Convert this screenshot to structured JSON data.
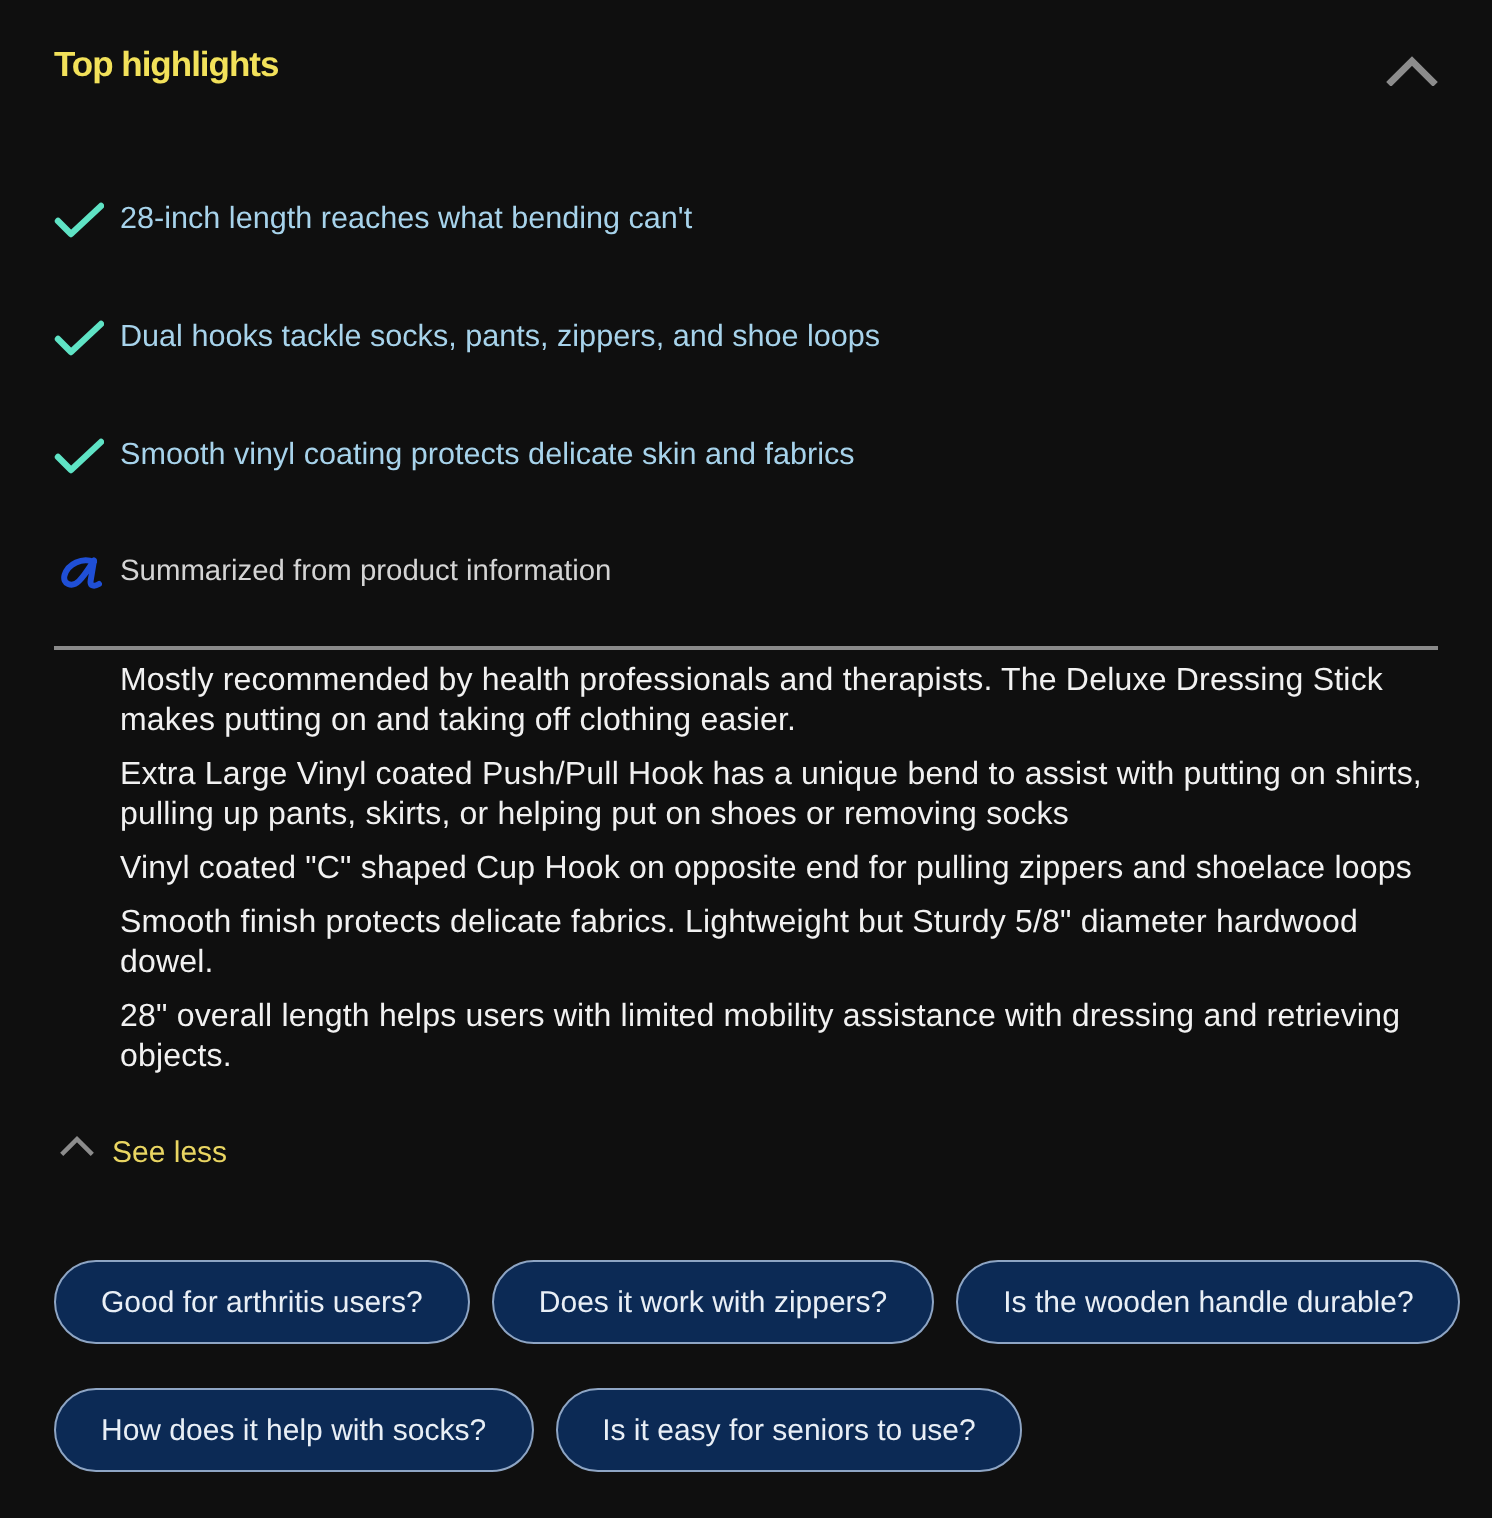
{
  "section": {
    "title": "Top highlights",
    "expanded": true
  },
  "highlights": [
    "28-inch length reaches what bending can't",
    "Dual hooks tackle socks, pants, zippers, and shoe loops",
    "Smooth vinyl coating protects delicate skin and fabrics"
  ],
  "source_note": "Summarized from product information",
  "details": [
    "Mostly recommended by health professionals and therapists. The Deluxe Dressing Stick makes putting on and taking off clothing easier.",
    "Extra Large Vinyl coated Push/Pull Hook has a unique bend to assist with putting on shirts, pulling up pants, skirts, or helping put on shoes or removing socks",
    "Vinyl coated \"C\" shaped Cup Hook on opposite end for pulling zippers and shoelace loops",
    "Smooth finish protects delicate fabrics. Lightweight but Sturdy 5/8\" diameter hardwood dowel.",
    "28\" overall length helps users with limited mobility assistance with dressing and retrieving objects."
  ],
  "toggle": {
    "label": "See less",
    "expanded": true
  },
  "suggested_questions": [
    "Good for arthritis users?",
    "Does it work with zippers?",
    "Is the wooden handle durable?",
    "How does it help with socks?",
    "Is it easy for seniors to use?"
  ]
}
